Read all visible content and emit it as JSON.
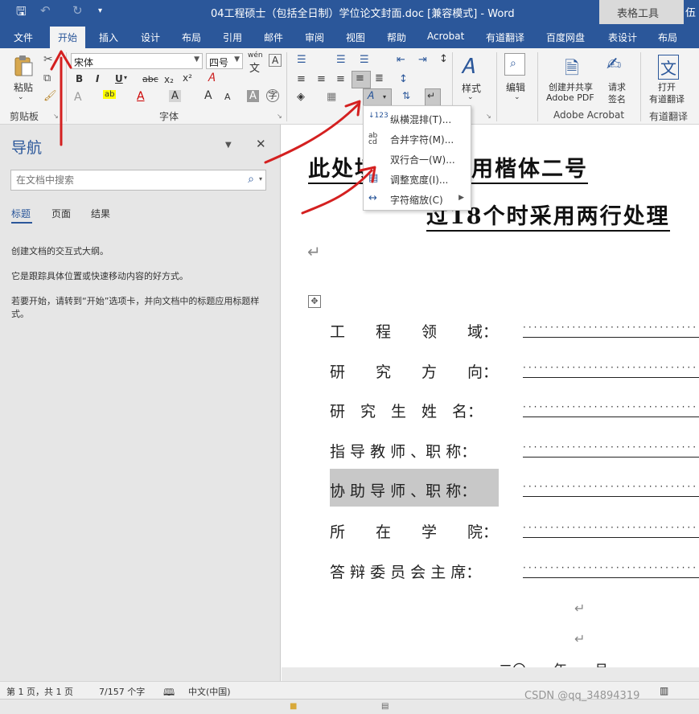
{
  "window": {
    "title": "04工程硕士（包括全日制）学位论文封面.doc [兼容模式] - Word",
    "table_tools": "表格工具",
    "user_initial": "伍"
  },
  "tabs": [
    "文件",
    "开始",
    "插入",
    "设计",
    "布局",
    "引用",
    "邮件",
    "审阅",
    "视图",
    "帮助",
    "Acrobat",
    "有道翻译",
    "百度网盘",
    "表设计",
    "布局"
  ],
  "active_tab": "开始",
  "ribbon": {
    "clipboard": {
      "paste": "粘贴",
      "group": "剪贴板"
    },
    "font": {
      "font_name": "宋体",
      "font_size": "四号",
      "wen_label": "wén",
      "group": "字体",
      "bold": "B",
      "italic": "I",
      "underline": "U",
      "strike": "abc",
      "subscript": "x₂",
      "superscript": "x²",
      "grow": "A",
      "shrink": "A"
    },
    "styles": {
      "label": "样式"
    },
    "editing": {
      "label": "编辑"
    },
    "acrobat": {
      "create_share": "创建并共享",
      "create_share2": "Adobe PDF",
      "request": "请求",
      "sign": "签名",
      "group": "Adobe Acrobat"
    },
    "youdao": {
      "open": "打开",
      "open2": "有道翻译",
      "group": "有道翻译"
    }
  },
  "context_menu": {
    "items": [
      {
        "label": "纵横混排(T)...",
        "icon": "vertical-horizontal-icon",
        "submenu": false
      },
      {
        "label": "合并字符(M)...",
        "icon": "combine-characters-icon",
        "submenu": false
      },
      {
        "label": "双行合一(W)...",
        "icon": "two-lines-in-one-icon",
        "submenu": false
      },
      {
        "label": "调整宽度(I)...",
        "icon": "fit-text-icon",
        "submenu": false
      },
      {
        "label": "字符缩放(C)",
        "icon": "character-scale-icon",
        "submenu": true
      }
    ]
  },
  "nav_pane": {
    "title": "导航",
    "search_placeholder": "在文档中搜索",
    "tabs": [
      "标题",
      "页面",
      "结果"
    ],
    "active_tab": "标题",
    "paragraphs": [
      "创建文档的交互式大纲。",
      "它是跟踪具体位置或快速移动内容的好方式。",
      "若要开始，请转到“开始”选项卡，并向文档中的标题应用标题样式。"
    ]
  },
  "document": {
    "title_line1": "此处填写题目，用楷体二号",
    "title_line2": "过18个时采用两行处理",
    "fields": [
      {
        "label": "工　　程　　领　　域：",
        "highlight": false
      },
      {
        "label": "研　　究　　方　　向：",
        "highlight": false
      },
      {
        "label": "研　究　生　姓　名：",
        "highlight": false
      },
      {
        "label": "指 导 教 师 、职 称：",
        "highlight": false
      },
      {
        "label": "协 助 导 师 、职 称：",
        "highlight": true
      },
      {
        "label": "所　　在　　学　　院：",
        "highlight": false
      },
      {
        "label": "答 辩 委 员 会 主 席：",
        "highlight": false
      }
    ],
    "date_line": "二〇　　年　　月"
  },
  "status_bar": {
    "page": "第 1 页，共 1 页",
    "words": "7/157 个字",
    "language": "中文(中国)"
  },
  "watermark": "CSDN @qq_34894319",
  "colors": {
    "accent": "#2b579a",
    "annotation": "#d42020",
    "highlight": "#c8c8c8"
  }
}
